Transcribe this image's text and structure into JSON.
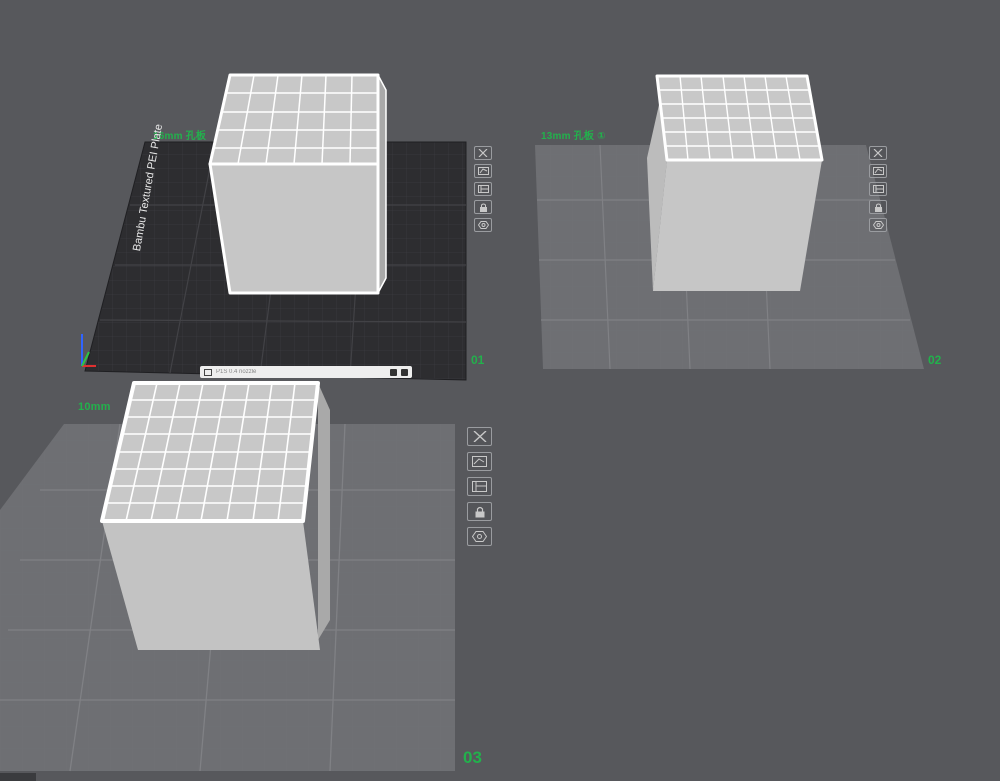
{
  "window": {
    "background": "#57585c"
  },
  "plates": [
    {
      "number": "01",
      "name": "16mm 孔板",
      "bed_label": "Bambu Textured PEI Plate",
      "active": true
    },
    {
      "number": "02",
      "name": "13mm 孔板 ①",
      "active": false
    },
    {
      "number": "03",
      "name": "10mm",
      "active": false
    }
  ],
  "plate_tools": [
    {
      "action": "delete",
      "icon": "close-icon"
    },
    {
      "action": "orient",
      "icon": "orient-icon"
    },
    {
      "action": "arrange",
      "icon": "arrange-icon"
    },
    {
      "action": "lock",
      "icon": "lock-icon"
    },
    {
      "action": "settings",
      "icon": "settings-icon"
    }
  ],
  "status_strip": {
    "text": "P1S 0.4 nozzle"
  },
  "colors": {
    "active_bed": "#2a2a2d",
    "inactive_bed": "#6b6c70",
    "plate_text": "#22b14c",
    "model_fill": "#c3c3c3",
    "model_outline": "#ffffff"
  }
}
